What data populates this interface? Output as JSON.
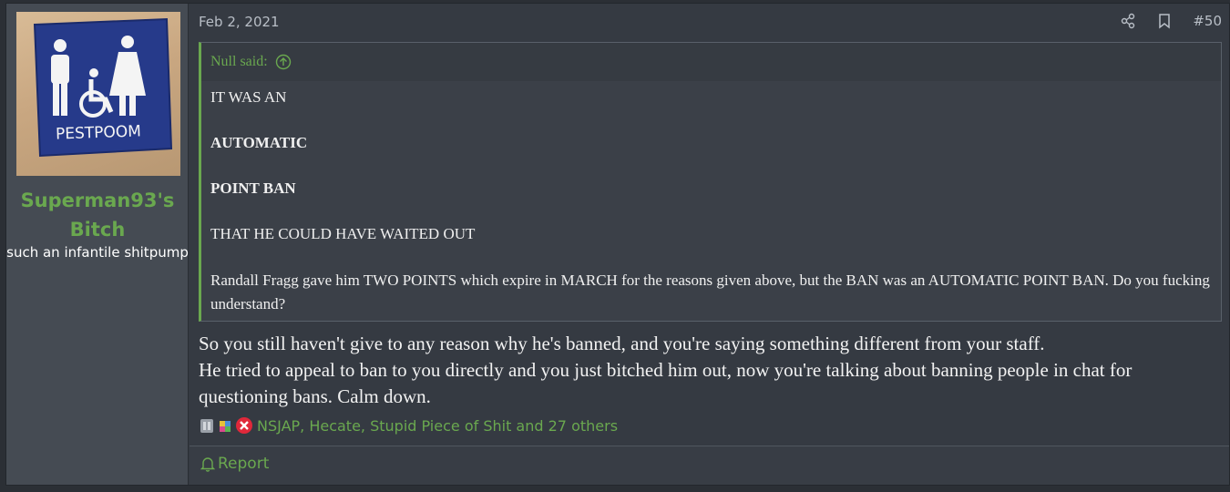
{
  "user": {
    "name": "Superman93's Bitch",
    "title": "such an infantile shitpump",
    "avatar_text": "PESTPOOM"
  },
  "post": {
    "date": "Feb 2, 2021",
    "number": "#50",
    "share_icon": "share-icon",
    "bookmark_icon": "bookmark-icon"
  },
  "quote": {
    "author": "Null said:",
    "lines": [
      "IT WAS AN",
      "AUTOMATIC",
      "POINT BAN",
      "THAT HE COULD HAVE WAITED OUT",
      "Randall Fragg gave him TWO POINTS which expire in MARCH for the reasons given above, but the BAN was an AUTOMATIC POINT BAN. Do you fucking understand?"
    ]
  },
  "message": {
    "line1": "So you still haven't give to any reason why he's banned, and you're saying something different from your staff.",
    "line2": "He tried to appeal to ban to you directly and you just bitched him out, now you're talking about banning people in chat for questioning bans. Calm down."
  },
  "reactions": {
    "text": "NSJAP, Hecate, Stupid Piece of Shit and 27 others"
  },
  "footer": {
    "report_label": "Report"
  },
  "colors": {
    "accent": "#6aa84f",
    "background": "#353a42"
  }
}
